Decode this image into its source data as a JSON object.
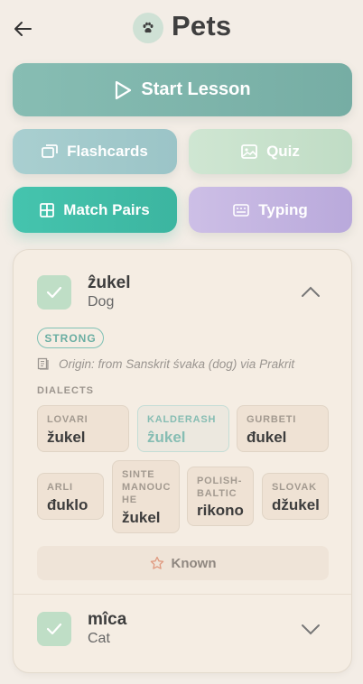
{
  "header": {
    "title": "Pets"
  },
  "actions": {
    "start_lesson": "Start Lesson",
    "flashcards": "Flashcards",
    "quiz": "Quiz",
    "match_pairs": "Match Pairs",
    "typing": "Typing"
  },
  "words": [
    {
      "word": "ẑukel",
      "meaning": "Dog",
      "known_checked": true,
      "expanded": true,
      "badge": "STRONG",
      "origin": "Origin: from Sanskrit śvaka (dog) via Prakrit",
      "dialects_label": "DIALECTS",
      "dialects": [
        {
          "name": "LOVARI",
          "value": "žukel",
          "active": false
        },
        {
          "name": "KALDERASH",
          "value": "ẑukel",
          "active": true
        },
        {
          "name": "GURBETI",
          "value": "đukel",
          "active": false
        },
        {
          "name": "ARLI",
          "value": "đuklo",
          "active": false
        },
        {
          "name": "SINTE MANOUCHE",
          "name_lines": [
            "SINTE",
            "MANOUC",
            "HE"
          ],
          "value": "žukel",
          "active": false
        },
        {
          "name": "POLISH-BALTIC",
          "name_lines": [
            "POLISH-",
            "BALTIC"
          ],
          "value": "rikono",
          "active": false
        },
        {
          "name": "SLOVAK",
          "value": "džukel",
          "active": false
        }
      ],
      "known_label": "Known"
    },
    {
      "word": "mîca",
      "meaning": "Cat",
      "known_checked": true,
      "expanded": false
    }
  ],
  "colors": {
    "background": "#f3ede6",
    "start": "#7fb6ad",
    "flashcards": "#a3cacc",
    "quiz": "#c8e2cc",
    "match_pairs": "#40bea8",
    "typing": "#c4b5e1",
    "accent": "#6aaea2"
  },
  "icons": {
    "back": "arrow-left-icon",
    "category": "paw-icon",
    "start": "play-icon",
    "flashcards": "cards-icon",
    "quiz": "image-icon",
    "match_pairs": "grid-icon",
    "typing": "keyboard-icon",
    "origin": "book-icon",
    "known": "star-icon"
  }
}
